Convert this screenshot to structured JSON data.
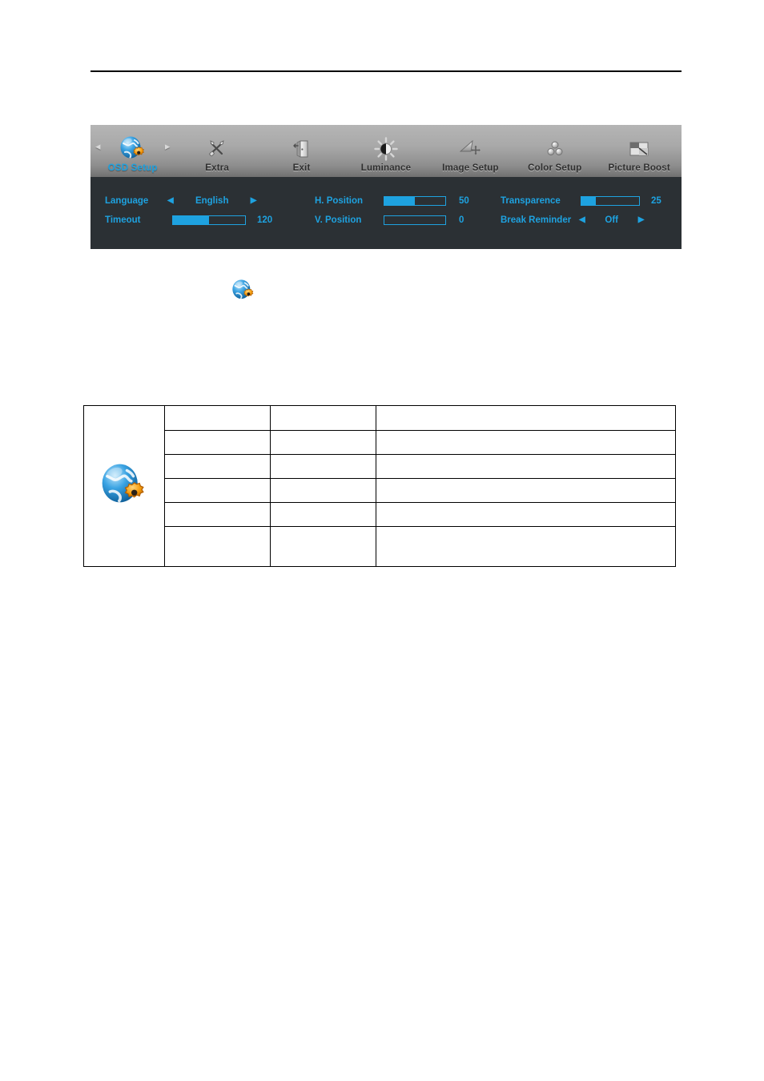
{
  "document": {
    "header_rule": true
  },
  "osd": {
    "tabs": [
      {
        "label": "OSD Setup",
        "icon": "globe-gear-icon",
        "active": true
      },
      {
        "label": "Extra",
        "icon": "crossed-tools-icon",
        "active": false
      },
      {
        "label": "Exit",
        "icon": "exit-door-icon",
        "active": false
      },
      {
        "label": "Luminance",
        "icon": "sun-brightness-icon",
        "active": false
      },
      {
        "label": "Image Setup",
        "icon": "image-move-icon",
        "active": false
      },
      {
        "label": "Color Setup",
        "icon": "three-circles-icon",
        "active": false
      },
      {
        "label": "Picture Boost",
        "icon": "picture-boost-icon",
        "active": false
      }
    ],
    "nav": {
      "prev": "◂",
      "next": "▸"
    },
    "arrows": {
      "left": "◀",
      "right": "▶"
    },
    "columns": {
      "left": [
        {
          "label": "Language",
          "type": "option",
          "value": "English"
        },
        {
          "label": "Timeout",
          "type": "slider",
          "value": "120",
          "fill_percent": 50
        }
      ],
      "middle": [
        {
          "label": "H. Position",
          "type": "slider",
          "value": "50",
          "fill_percent": 50
        },
        {
          "label": "V. Position",
          "type": "slider",
          "value": "0",
          "fill_percent": 0
        }
      ],
      "right": [
        {
          "label": "Transparence",
          "type": "slider",
          "value": "25",
          "fill_percent": 25
        },
        {
          "label": "Break Reminder",
          "type": "option",
          "value": "Off"
        }
      ]
    },
    "colors": {
      "accent": "#1ea2e0",
      "panel_background": "#2b3034",
      "tabbar_top": "#b5b5b5",
      "tabbar_bottom": "#707070"
    }
  },
  "loose_icon": {
    "name": "osd-setup-icon"
  },
  "spec_table": {
    "icon_cell": {
      "name": "osd-setup-icon"
    },
    "rows": [
      {
        "cells": [
          "",
          "",
          ""
        ]
      },
      {
        "cells": [
          "",
          "",
          ""
        ]
      },
      {
        "cells": [
          "",
          "",
          ""
        ]
      },
      {
        "cells": [
          "",
          "",
          ""
        ]
      },
      {
        "cells": [
          "",
          "",
          ""
        ]
      },
      {
        "cells": [
          "",
          "",
          ""
        ]
      }
    ]
  }
}
